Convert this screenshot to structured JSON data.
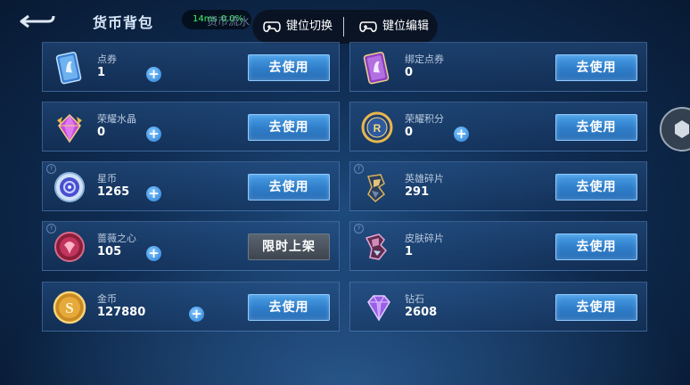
{
  "header": {
    "title": "货币背包",
    "perf_ping": "14ms",
    "perf_loss": "0.0%",
    "flow_link": "货币流水"
  },
  "key_panel": {
    "switch_label": "键位切换",
    "edit_label": "键位编辑"
  },
  "currencies": [
    {
      "name": "点券",
      "amount": "1",
      "has_plus": true,
      "action": "去使用",
      "icon": "coupon-card-icon"
    },
    {
      "name": "绑定点券",
      "amount": "0",
      "has_plus": false,
      "action": "去使用",
      "icon": "bound-coupon-card-icon"
    },
    {
      "name": "荣耀水晶",
      "amount": "0",
      "has_plus": true,
      "action": "去使用",
      "icon": "glory-crystal-icon"
    },
    {
      "name": "荣耀积分",
      "amount": "0",
      "has_plus": true,
      "action": "去使用",
      "icon": "glory-points-icon"
    },
    {
      "name": "星币",
      "amount": "1265",
      "has_plus": true,
      "action": "去使用",
      "icon": "star-coin-icon"
    },
    {
      "name": "英雄碎片",
      "amount": "291",
      "has_plus": false,
      "action": "去使用",
      "icon": "hero-fragment-icon"
    },
    {
      "name": "蔷薇之心",
      "amount": "105",
      "has_plus": true,
      "action": "限时上架",
      "icon": "rose-heart-icon"
    },
    {
      "name": "皮肤碎片",
      "amount": "1",
      "has_plus": false,
      "action": "去使用",
      "icon": "skin-fragment-icon"
    },
    {
      "name": "金币",
      "amount": "127880",
      "has_plus": true,
      "action": "去使用",
      "icon": "gold-coin-icon"
    },
    {
      "name": "钻石",
      "amount": "2608",
      "has_plus": false,
      "action": "去使用",
      "icon": "diamond-icon"
    }
  ],
  "colors": {
    "accent_button": "#3a8ad6",
    "disabled_button": "#4a535e",
    "ping_green": "#3bf56a"
  }
}
